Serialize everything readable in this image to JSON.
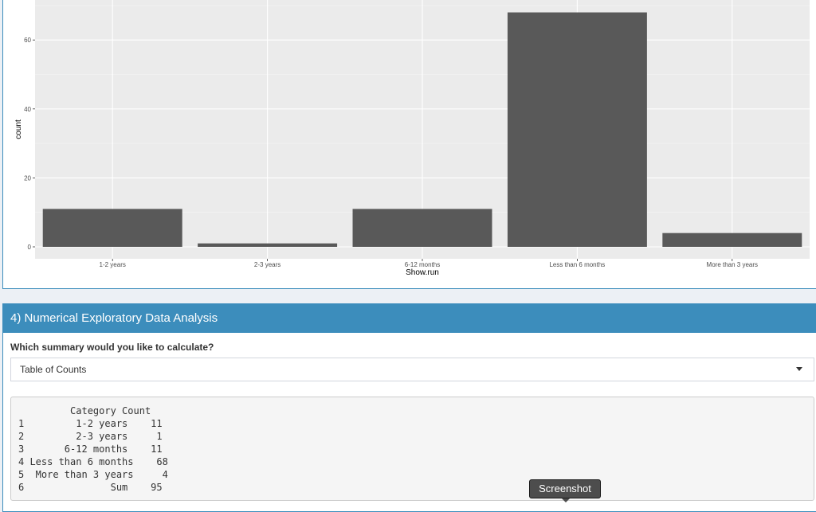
{
  "chart_data": {
    "type": "bar",
    "categories": [
      "1-2 years",
      "2-3 years",
      "6-12 months",
      "Less than 6 months",
      "More than 3 years"
    ],
    "values": [
      11,
      1,
      11,
      68,
      4
    ],
    "xlabel": "Show.run",
    "ylabel": "count",
    "yticks": [
      0,
      20,
      40,
      60
    ],
    "ylim": [
      0,
      71.5
    ],
    "bar_color": "#595959",
    "panel_color": "#ebebeb",
    "grid": true
  },
  "section": {
    "title": "4) Numerical Exploratory Data Analysis",
    "question": "Which summary would you like to calculate?",
    "select_value": "Table of Counts",
    "output": "         Category Count\n1         1-2 years    11\n2         2-3 years     1\n3       6-12 months    11\n4 Less than 6 months    68\n5  More than 3 years     4\n6               Sum    95"
  },
  "tooltip": {
    "label": "Screenshot"
  },
  "colors": {
    "header": "#3c8dbc",
    "background": "#ecf0f5"
  }
}
